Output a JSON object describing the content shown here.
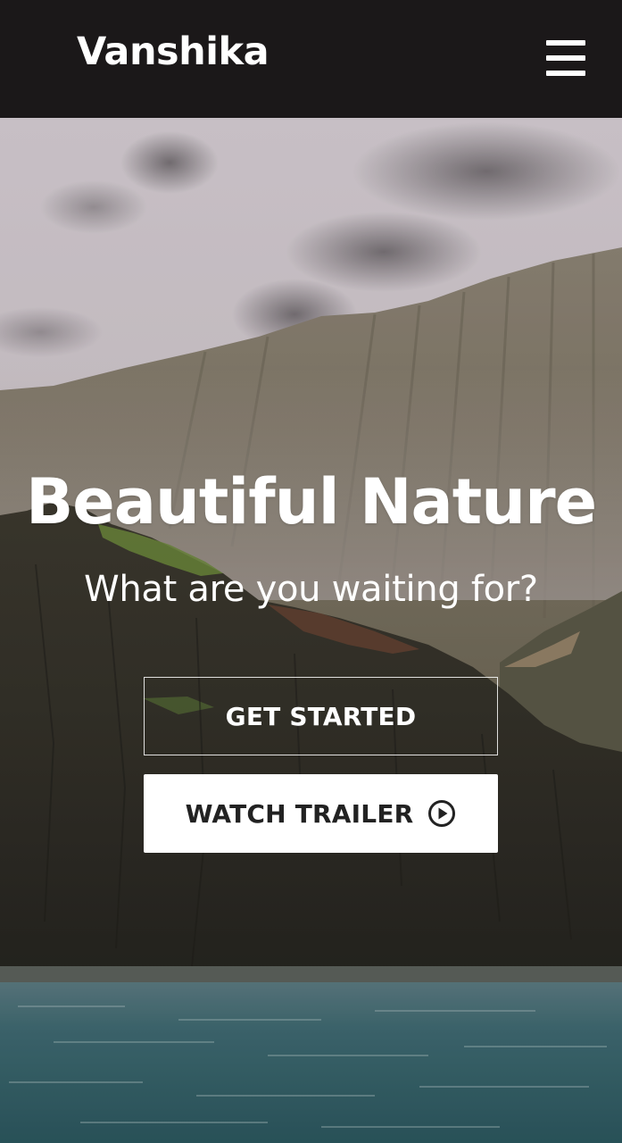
{
  "navbar": {
    "brand": "Vanshika",
    "menu_icon": "hamburger-menu-icon"
  },
  "hero": {
    "title": "Beautiful Nature",
    "subtitle": "What are you waiting for?",
    "get_started_label": "GET STARTED",
    "watch_trailer_label": "WATCH TRAILER",
    "watch_trailer_icon": "play-circle-icon"
  },
  "colors": {
    "navbar_bg": "#1b1819",
    "text_light": "#ffffff",
    "button_solid_bg": "#ffffff",
    "button_solid_text": "#222222"
  }
}
